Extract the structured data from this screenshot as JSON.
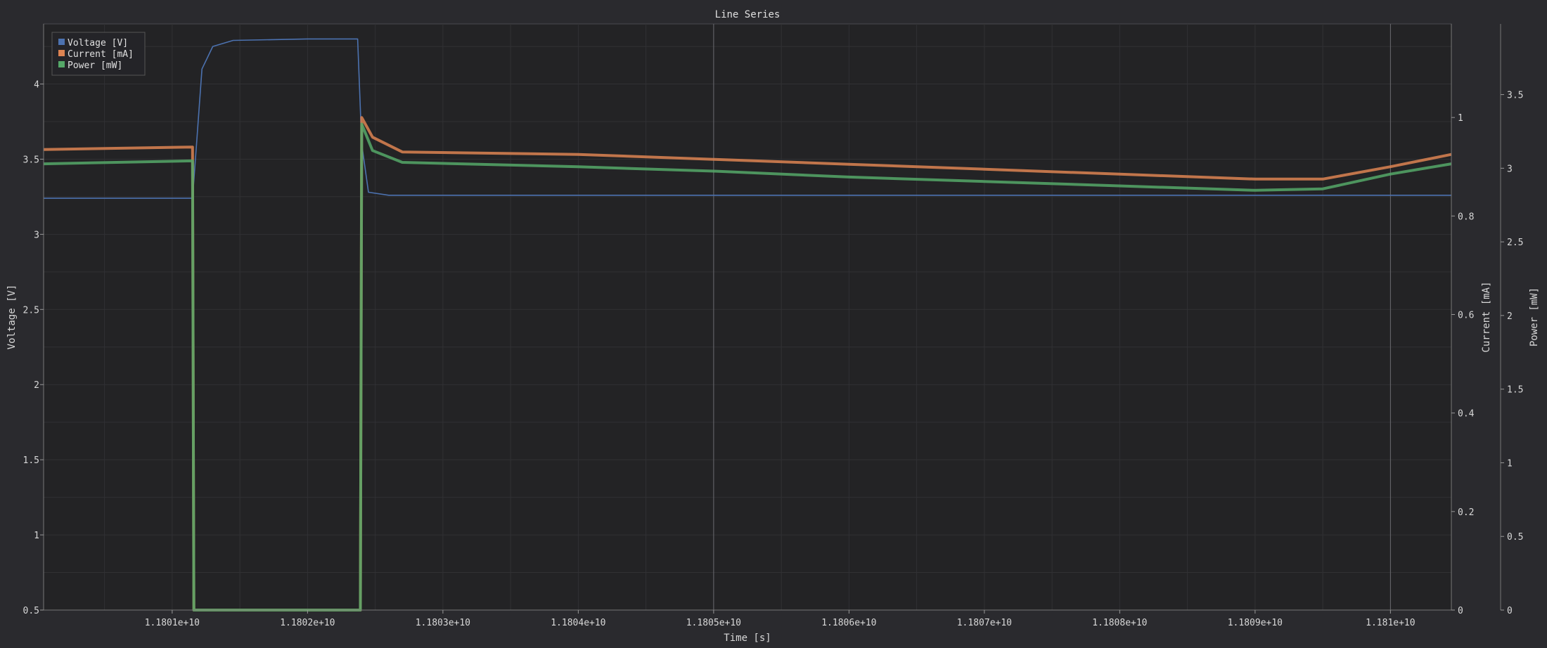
{
  "chart_data": {
    "type": "line",
    "title": "Line Series",
    "xlabel": "Time [s]",
    "xlim": [
      11800050000,
      11810450000
    ],
    "x_ticks": [
      11801000000,
      11802000000,
      11803000000,
      11804000000,
      11805000000,
      11806000000,
      11807000000,
      11808000000,
      11809000000,
      11810000000
    ],
    "x_tick_labels": [
      "1.1801e+10",
      "1.1802e+10",
      "1.1803e+10",
      "1.1804e+10",
      "1.1805e+10",
      "1.1806e+10",
      "1.1807e+10",
      "1.1808e+10",
      "1.1809e+10",
      "1.181e+10"
    ],
    "highlight_x": [
      11805000000,
      11810000000
    ],
    "grid": true,
    "legend_position": "top-left",
    "axes": [
      {
        "id": "y1",
        "side": "left",
        "label": "Voltage [V]",
        "lim": [
          0.5,
          4.4
        ],
        "ticks": [
          0.5,
          1,
          1.5,
          2,
          2.5,
          3,
          3.5,
          4
        ],
        "tick_labels": [
          "0.5",
          "1",
          "1.5",
          "2",
          "2.5",
          "3",
          "3.5",
          "4"
        ]
      },
      {
        "id": "y2",
        "side": "right",
        "label": "Current [mA]",
        "lim": [
          0,
          1.19
        ],
        "ticks": [
          0,
          0.2,
          0.4,
          0.6,
          0.8,
          1
        ],
        "tick_labels": [
          "0",
          "0.2",
          "0.4",
          "0.6",
          "0.8",
          "1"
        ]
      },
      {
        "id": "y3",
        "side": "right",
        "label": "Power [mW]",
        "lim": [
          0,
          3.98
        ],
        "ticks": [
          0,
          0.5,
          1,
          1.5,
          2,
          2.5,
          3,
          3.5
        ],
        "tick_labels": [
          "0",
          "0.5",
          "1",
          "1.5",
          "2",
          "2.5",
          "3",
          "3.5"
        ]
      }
    ],
    "series": [
      {
        "name": "Voltage [V]",
        "axis": "y1",
        "color": "#4c72b0",
        "points": [
          [
            11800050000,
            3.24
          ],
          [
            11801150000,
            3.24
          ],
          [
            11801180000,
            3.6
          ],
          [
            11801220000,
            4.1
          ],
          [
            11801300000,
            4.25
          ],
          [
            11801450000,
            4.29
          ],
          [
            11802000000,
            4.3
          ],
          [
            11802370000,
            4.3
          ],
          [
            11802400000,
            3.6
          ],
          [
            11802450000,
            3.28
          ],
          [
            11802600000,
            3.26
          ],
          [
            11805000000,
            3.26
          ],
          [
            11810450000,
            3.26
          ]
        ]
      },
      {
        "name": "Current [mA]",
        "axis": "y2",
        "color": "#dd8452",
        "points": [
          [
            11800050000,
            0.935
          ],
          [
            11801150000,
            0.94
          ],
          [
            11801160000,
            0.0
          ],
          [
            11802390000,
            0.0
          ],
          [
            11802400000,
            1.0
          ],
          [
            11802480000,
            0.96
          ],
          [
            11802700000,
            0.93
          ],
          [
            11804000000,
            0.925
          ],
          [
            11805000000,
            0.915
          ],
          [
            11806000000,
            0.905
          ],
          [
            11807000000,
            0.895
          ],
          [
            11808000000,
            0.885
          ],
          [
            11809000000,
            0.875
          ],
          [
            11809500000,
            0.875
          ],
          [
            11810000000,
            0.9
          ],
          [
            11810450000,
            0.925
          ]
        ]
      },
      {
        "name": "Power [mW]",
        "axis": "y3",
        "color": "#55a868",
        "points": [
          [
            11800050000,
            3.03
          ],
          [
            11801150000,
            3.05
          ],
          [
            11801160000,
            0.0
          ],
          [
            11802390000,
            0.0
          ],
          [
            11802400000,
            3.3
          ],
          [
            11802480000,
            3.12
          ],
          [
            11802700000,
            3.04
          ],
          [
            11804000000,
            3.01
          ],
          [
            11805000000,
            2.98
          ],
          [
            11806000000,
            2.94
          ],
          [
            11807000000,
            2.91
          ],
          [
            11808000000,
            2.88
          ],
          [
            11809000000,
            2.85
          ],
          [
            11809500000,
            2.86
          ],
          [
            11810000000,
            2.96
          ],
          [
            11810450000,
            3.03
          ]
        ]
      }
    ]
  }
}
